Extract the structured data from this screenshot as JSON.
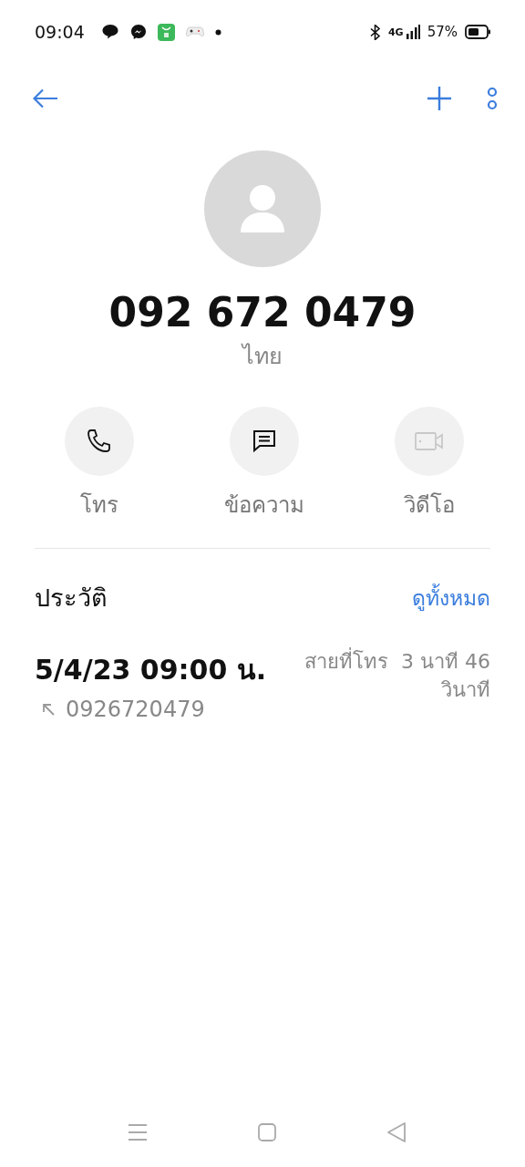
{
  "status_bar": {
    "time": "09:04",
    "network": "4G",
    "battery": "57%"
  },
  "contact": {
    "number": "092 672 0479",
    "location": "ไทย"
  },
  "actions": [
    {
      "kind": "call",
      "label": "โทร",
      "disabled": false
    },
    {
      "kind": "message",
      "label": "ข้อความ",
      "disabled": false
    },
    {
      "kind": "video",
      "label": "วิดีโอ",
      "disabled": true
    }
  ],
  "history": {
    "title": "ประวัติ",
    "see_all": "ดูทั้งหมด",
    "entries": [
      {
        "datetime": "5/4/23 09:00 น.",
        "number": "0926720479",
        "call_type": "สายที่โทร",
        "duration": "3 นาที 46 วินาที"
      }
    ]
  }
}
